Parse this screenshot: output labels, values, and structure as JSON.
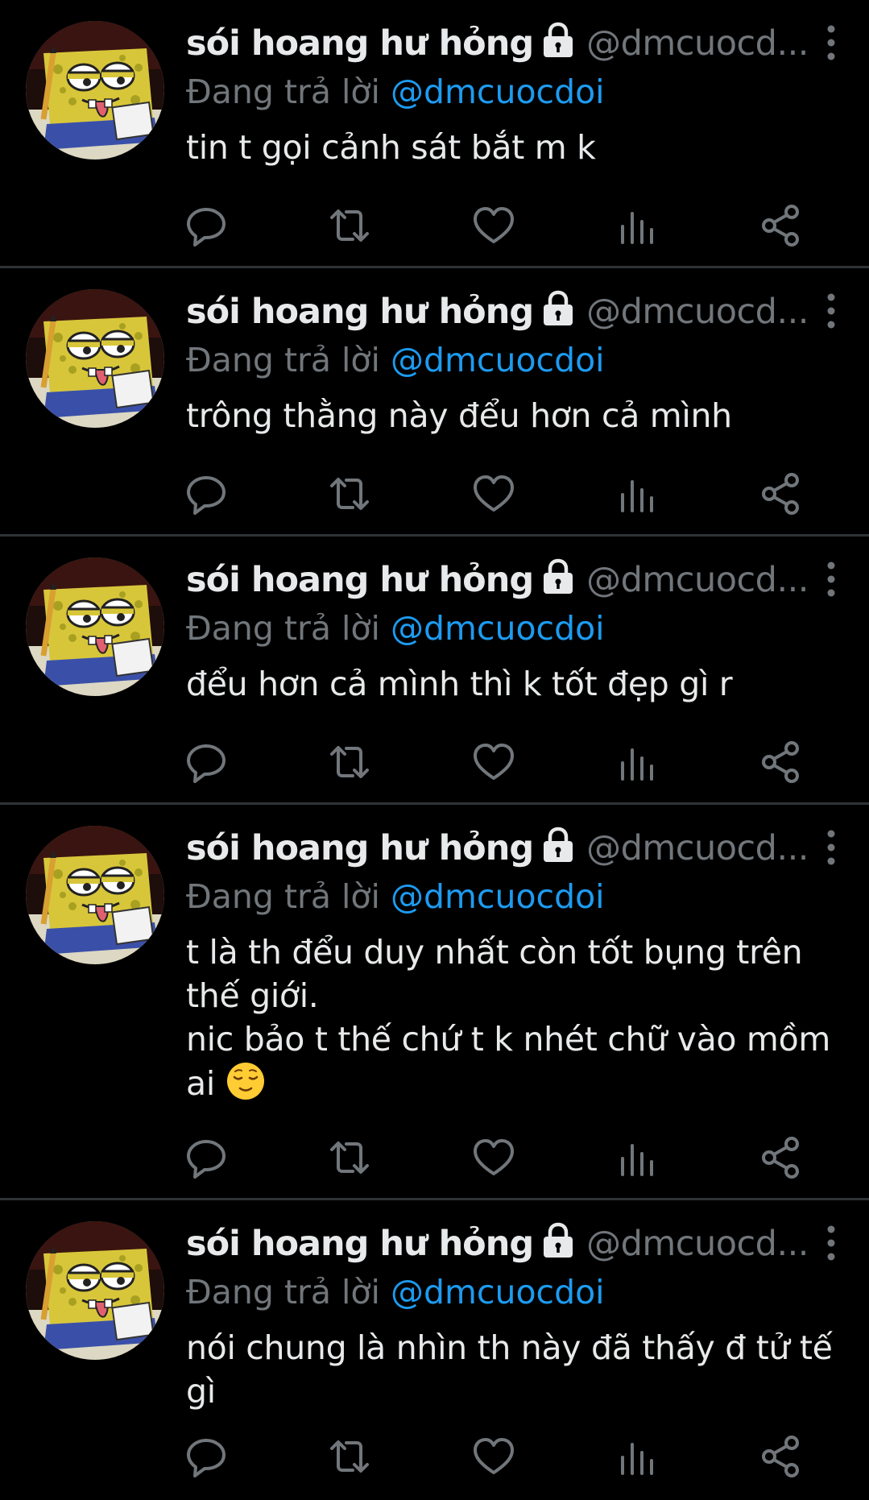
{
  "colors": {
    "background": "#000000",
    "text_primary": "#e7e9ea",
    "text_secondary": "#71767b",
    "accent": "#1d9bf0",
    "divider": "#2f3336"
  },
  "tweets": [
    {
      "author_name": "sói hoang hư hỏng",
      "author_handle": "@dmcuocd...",
      "locked_icon": "lock-icon",
      "reply_prefix": "Đang trả lời",
      "reply_to": "@dmcuocdoi",
      "text_lines": [
        "tin t gọi cảnh sát bắt m k"
      ]
    },
    {
      "author_name": "sói hoang hư hỏng",
      "author_handle": "@dmcuocd...",
      "locked_icon": "lock-icon",
      "reply_prefix": "Đang trả lời",
      "reply_to": "@dmcuocdoi",
      "text_lines": [
        "trông thằng này đểu hơn cả mình"
      ]
    },
    {
      "author_name": "sói hoang hư hỏng",
      "author_handle": "@dmcuocd...",
      "locked_icon": "lock-icon",
      "reply_prefix": "Đang trả lời",
      "reply_to": "@dmcuocdoi",
      "text_lines": [
        "đểu hơn cả mình thì k tốt đẹp gì r"
      ]
    },
    {
      "author_name": "sói hoang hư hỏng",
      "author_handle": "@dmcuocd...",
      "locked_icon": "lock-icon",
      "reply_prefix": "Đang trả lời",
      "reply_to": "@dmcuocdoi",
      "text_lines": [
        "t là th đểu duy nhất còn tốt bụng trên",
        "thế giới.",
        "nic bảo t thế chứ t k nhét chữ vào mồm",
        "ai"
      ],
      "trailing_emoji": "relieved-face-emoji"
    },
    {
      "author_name": "sói hoang hư hỏng",
      "author_handle": "@dmcuocd...",
      "locked_icon": "lock-icon",
      "reply_prefix": "Đang trả lời",
      "reply_to": "@dmcuocdoi",
      "text_lines": [
        "nói chung là nhìn th này đã thấy đ tử tế",
        "gì"
      ]
    }
  ],
  "action_icons": [
    "reply-icon",
    "retweet-icon",
    "like-icon",
    "views-icon",
    "share-icon"
  ]
}
